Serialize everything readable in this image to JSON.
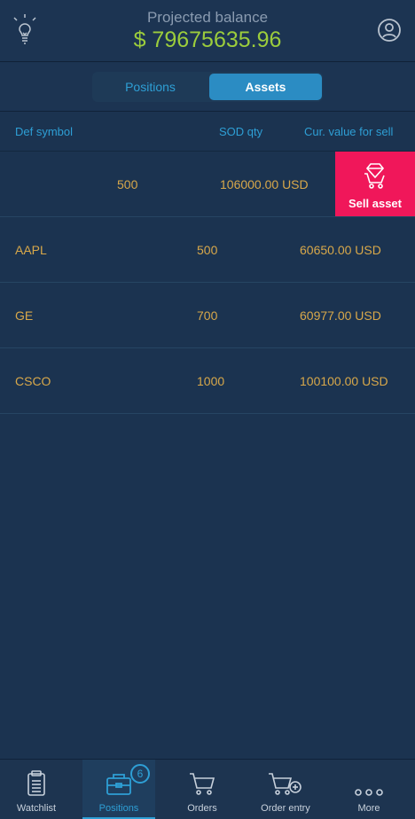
{
  "header": {
    "title": "Projected balance",
    "balance": "$ 79675635.96",
    "left_icon": "lightbulb-icon",
    "right_icon": "user-profile-icon"
  },
  "segmented": {
    "tabs": [
      {
        "label": "Positions",
        "active": false
      },
      {
        "label": "Assets",
        "active": true
      }
    ]
  },
  "columns": {
    "symbol": "Def symbol",
    "sod_qty": "SOD qty",
    "cur_value": "Cur. value for sell"
  },
  "swiped_row": {
    "qty": "500",
    "value": "106000.00 USD",
    "action_label": "Sell asset",
    "action_icon": "cart-diamond-icon"
  },
  "rows": [
    {
      "symbol": "AAPL",
      "qty": "500",
      "value": "60650.00 USD"
    },
    {
      "symbol": "GE",
      "qty": "700",
      "value": "60977.00 USD"
    },
    {
      "symbol": "CSCO",
      "qty": "1000",
      "value": "100100.00 USD"
    }
  ],
  "tabbar": {
    "items": [
      {
        "label": "Watchlist",
        "icon": "clipboard-icon"
      },
      {
        "label": "Positions",
        "icon": "briefcase-icon",
        "badge": "6",
        "active": true
      },
      {
        "label": "Orders",
        "icon": "cart-icon"
      },
      {
        "label": "Order entry",
        "icon": "cart-plus-icon"
      },
      {
        "label": "More",
        "icon": "more-dots-icon"
      }
    ]
  },
  "colors": {
    "background": "#1b3350",
    "accent": "#2e9fd5",
    "value_text": "#d8a84a",
    "balance": "#9ccd3c",
    "sell": "#f0175a"
  }
}
